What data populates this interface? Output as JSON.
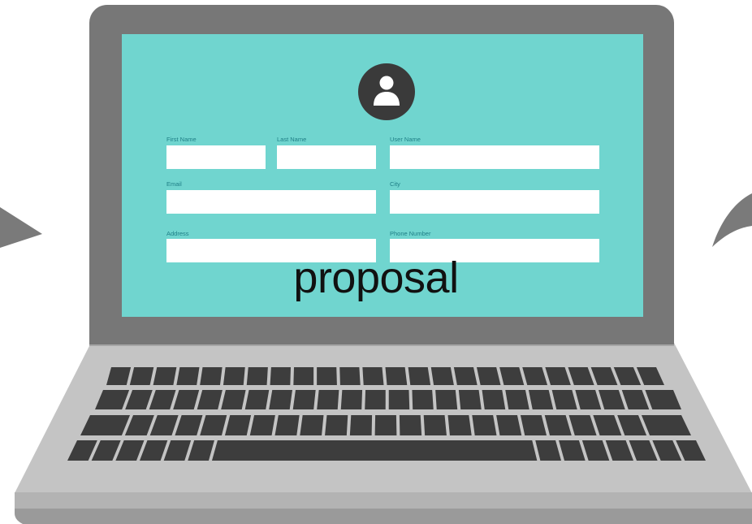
{
  "form": {
    "first_name_label": "First Name",
    "last_name_label": "Last Name",
    "user_name_label": "User Name",
    "email_label": "Email",
    "city_label": "City",
    "address_label": "Address",
    "phone_number_label": "Phone Number",
    "first_name_value": "",
    "last_name_value": "",
    "user_name_value": "",
    "email_value": "",
    "city_value": "",
    "address_value": "",
    "phone_number_value": ""
  },
  "overlay": {
    "text": "proposal"
  },
  "icons": {
    "avatar": "user-icon",
    "left_decoration": "arrow-left-decoration",
    "right_decoration": "curved-arrow-right-decoration"
  },
  "colors": {
    "screen": "#70d5cf",
    "bezel": "#777777",
    "base": "#c4c4c4",
    "keys": "#3d3d3d",
    "avatar": "#3a3a3a",
    "label": "#1f7f86",
    "overlay_text": "#111111"
  }
}
